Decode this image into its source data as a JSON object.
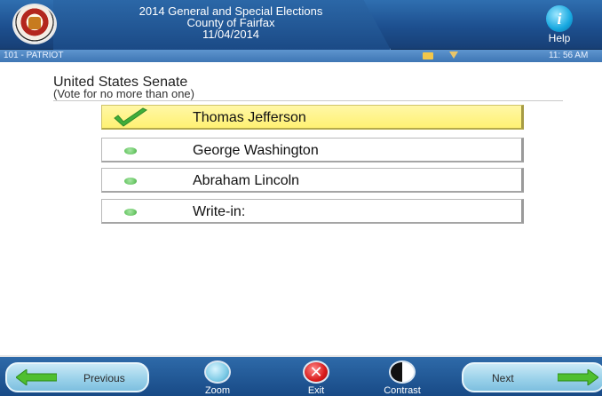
{
  "header": {
    "election_title": "2014 General and Special Elections",
    "county": "County of Fairfax",
    "date": "11/04/2014",
    "help_label": "Help"
  },
  "status_bar": {
    "precinct": "101 - PATRIOT",
    "time": "11: 56 AM"
  },
  "contest": {
    "title": "United States Senate",
    "instructions": "(Vote for no more than one)",
    "candidates": [
      {
        "name": "Thomas Jefferson",
        "selected": true
      },
      {
        "name": "George Washington",
        "selected": false
      },
      {
        "name": "Abraham Lincoln",
        "selected": false
      },
      {
        "name": "Write-in:",
        "selected": false
      }
    ]
  },
  "footer": {
    "previous_label": "Previous",
    "zoom_label": "Zoom",
    "exit_label": "Exit",
    "exit_icon_glyph": "✕",
    "contrast_label": "Contrast",
    "next_label": "Next"
  },
  "colors": {
    "header_blue": "#1d4f8f",
    "selected_yellow": "#fff173",
    "check_green": "#3fae3a",
    "arrow_green": "#4fbf2f"
  }
}
